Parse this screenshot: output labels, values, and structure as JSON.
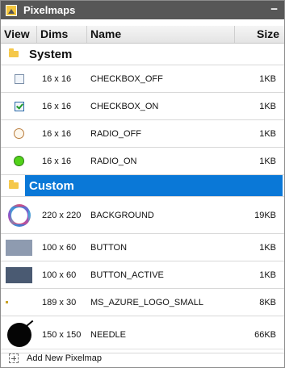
{
  "window": {
    "title": "Pixelmaps",
    "minimize_glyph": "−"
  },
  "columns": {
    "view": "View",
    "dims": "Dims",
    "name": "Name",
    "size": "Size"
  },
  "groups": [
    {
      "label": "System",
      "selected": false,
      "items": [
        {
          "icon": "checkbox-off-icon",
          "dims": "16 x 16",
          "name": "CHECKBOX_OFF",
          "size": "1KB"
        },
        {
          "icon": "checkbox-on-icon",
          "dims": "16 x 16",
          "name": "CHECKBOX_ON",
          "size": "1KB"
        },
        {
          "icon": "radio-off-icon",
          "dims": "16 x 16",
          "name": "RADIO_OFF",
          "size": "1KB"
        },
        {
          "icon": "radio-on-icon",
          "dims": "16 x 16",
          "name": "RADIO_ON",
          "size": "1KB"
        }
      ]
    },
    {
      "label": "Custom",
      "selected": true,
      "items": [
        {
          "icon": "background-ring-icon",
          "dims": "220 x 220",
          "name": "BACKGROUND",
          "size": "19KB"
        },
        {
          "icon": "button-preview-icon",
          "dims": "100 x 60",
          "name": "BUTTON",
          "size": "1KB"
        },
        {
          "icon": "button-active-preview-icon",
          "dims": "100 x 60",
          "name": "BUTTON_ACTIVE",
          "size": "1KB"
        },
        {
          "icon": "logo-preview-icon",
          "dims": "189 x 30",
          "name": "MS_AZURE_LOGO_SMALL",
          "size": "8KB"
        },
        {
          "icon": "needle-preview-icon",
          "dims": "150 x 150",
          "name": "NEEDLE",
          "size": "66KB"
        }
      ]
    }
  ],
  "footer": {
    "add_label": "Add New Pixelmap"
  },
  "colors": {
    "titlebar": "#575757",
    "selection": "#0a78d7",
    "folder": "#f5c84a"
  }
}
